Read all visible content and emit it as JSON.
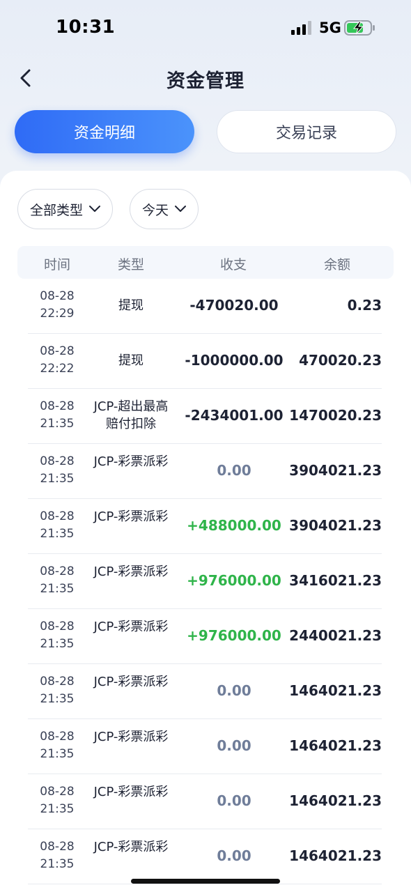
{
  "status_bar": {
    "time": "10:31",
    "network": "5G"
  },
  "nav": {
    "title": "资金管理"
  },
  "tabs": [
    {
      "label": "资金明细",
      "active": true
    },
    {
      "label": "交易记录",
      "active": false
    }
  ],
  "filters": {
    "type_label": "全部类型",
    "date_label": "今天"
  },
  "table": {
    "headers": {
      "time": "时间",
      "type": "类型",
      "change": "收支",
      "balance": "余额"
    },
    "rows": [
      {
        "date": "08-28",
        "time": "22:29",
        "type": "提现",
        "change": "-470020.00",
        "balance": "0.23",
        "kind": "negative"
      },
      {
        "date": "08-28",
        "time": "22:22",
        "type": "提现",
        "change": "-1000000.00",
        "balance": "470020.23",
        "kind": "negative"
      },
      {
        "date": "08-28",
        "time": "21:35",
        "type": "JCP-超出最高赔付扣除",
        "change": "-2434001.00",
        "balance": "1470020.23",
        "kind": "negative"
      },
      {
        "date": "08-28",
        "time": "21:35",
        "type": "JCP-彩票派彩",
        "change": "0.00",
        "balance": "3904021.23",
        "kind": "zero"
      },
      {
        "date": "08-28",
        "time": "21:35",
        "type": "JCP-彩票派彩",
        "change": "+488000.00",
        "balance": "3904021.23",
        "kind": "positive"
      },
      {
        "date": "08-28",
        "time": "21:35",
        "type": "JCP-彩票派彩",
        "change": "+976000.00",
        "balance": "3416021.23",
        "kind": "positive"
      },
      {
        "date": "08-28",
        "time": "21:35",
        "type": "JCP-彩票派彩",
        "change": "+976000.00",
        "balance": "2440021.23",
        "kind": "positive"
      },
      {
        "date": "08-28",
        "time": "21:35",
        "type": "JCP-彩票派彩",
        "change": "0.00",
        "balance": "1464021.23",
        "kind": "zero"
      },
      {
        "date": "08-28",
        "time": "21:35",
        "type": "JCP-彩票派彩",
        "change": "0.00",
        "balance": "1464021.23",
        "kind": "zero"
      },
      {
        "date": "08-28",
        "time": "21:35",
        "type": "JCP-彩票派彩",
        "change": "0.00",
        "balance": "1464021.23",
        "kind": "zero"
      },
      {
        "date": "08-28",
        "time": "21:35",
        "type": "JCP-彩票派彩",
        "change": "0.00",
        "balance": "1464021.23",
        "kind": "zero"
      }
    ]
  },
  "colors": {
    "accent": "#2f6bf6",
    "positive": "#2fb44a",
    "zero": "#6f7d99"
  }
}
